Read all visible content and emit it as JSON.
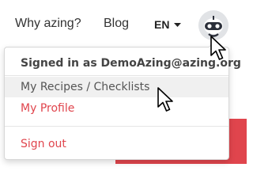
{
  "nav": {
    "why_label": "Why azing?",
    "blog_label": "Blog",
    "language": "EN",
    "caret_icon": "caret-down-icon",
    "avatar_icon": "robot-avatar-icon"
  },
  "dropdown": {
    "header": "Signed in as DemoAzing@azing.org",
    "items": [
      {
        "label": "My Recipes / Checklists",
        "state": "hover",
        "color": "#555555"
      },
      {
        "label": "My Profile",
        "color": "#e0454d"
      },
      {
        "label": "Sign out",
        "color": "#e0454d"
      }
    ]
  },
  "colors": {
    "accent": "#e0454d",
    "hover_bg": "#f0f0f0",
    "divider": "#e5e5e5"
  },
  "cursors": [
    "arrow-cursor-icon",
    "arrow-cursor-icon"
  ]
}
